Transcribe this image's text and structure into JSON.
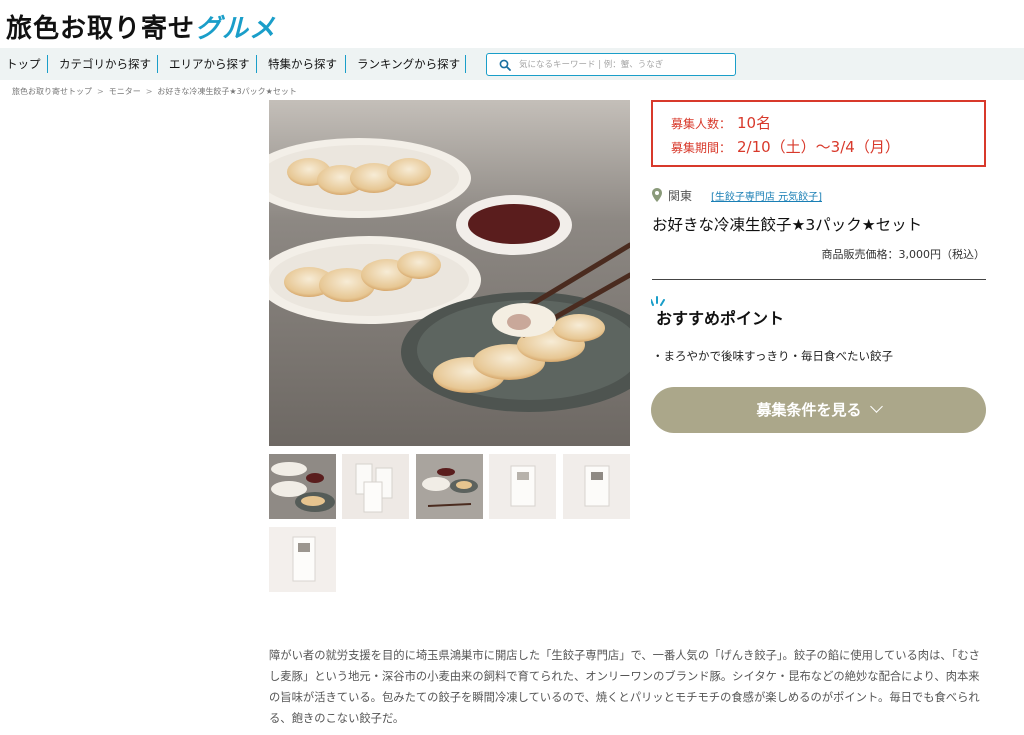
{
  "header": {
    "logo_part1": "旅色お取り寄せ",
    "logo_part2": "グルメ"
  },
  "nav": {
    "items": [
      {
        "label": "トップ"
      },
      {
        "label": "カテゴリから探す"
      },
      {
        "label": "エリアから探す"
      },
      {
        "label": "特集から探す"
      },
      {
        "label": "ランキングから探す"
      }
    ],
    "search_placeholder": "気になるキーワード | 例：蟹、うなぎ"
  },
  "breadcrumb": {
    "items": [
      {
        "label": "旅色お取り寄せトップ"
      },
      {
        "label": "モニター"
      },
      {
        "label": "お好きな冷凍生餃子★3パック★セット"
      }
    ],
    "separator": ">"
  },
  "recruit": {
    "count_label": "募集人数：",
    "count_value": "10名",
    "period_label": "募集期間：",
    "period_value": "2/10（土）～3/4（月）",
    "border_color": "#d8392b"
  },
  "product": {
    "region": "関東",
    "shop": "[生餃子専門店 元気餃子]",
    "title": "お好きな冷凍生餃子★3パック★セット",
    "price": "商品販売価格：3,000円（税込）"
  },
  "recommend": {
    "heading": "おすすめポイント",
    "point": "・まろやかで後味すっきり・毎日食べたい餃子"
  },
  "cta": {
    "label": "募集条件を見る",
    "color": "#aba78a"
  },
  "description": "障がい者の就労支援を目的に埼玉県鴻巣市に開店した「生餃子専門店」で、一番人気の「げんき餃子」。餃子の餡に使用している肉は、「むさし麦豚」という地元・深谷市の小麦由来の飼料で育てられた、オンリーワンのブランド豚。シイタケ・昆布などの絶妙な配合により、肉本来の旨味が活きている。包みたての餃子を瞬間冷凍しているので、焼くとパリッとモチモチの食感が楽しめるのがポイント。毎日でも食べられる、飽きのこない餃子だ。",
  "colors": {
    "accent": "#1a9ec9",
    "nav_bg": "#eef3f3"
  }
}
